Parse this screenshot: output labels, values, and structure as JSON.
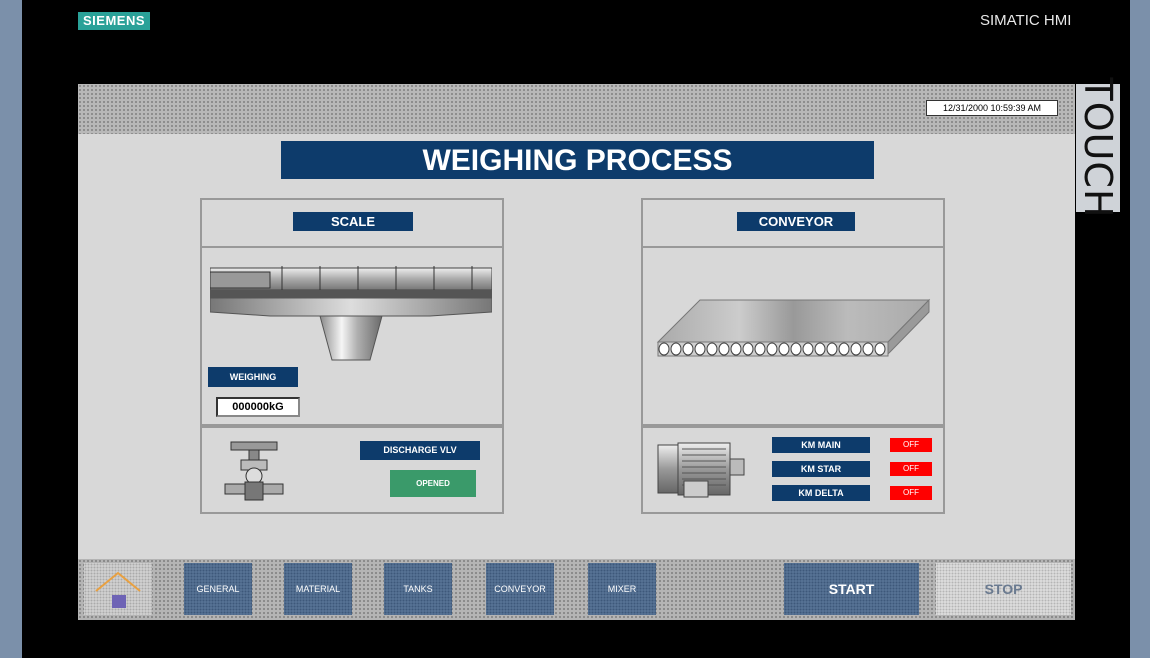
{
  "device": {
    "brand": "SIEMENS",
    "model": "SIMATIC HMI",
    "touch_label": "TOUCH"
  },
  "screen": {
    "datetime": "12/31/2000 10:59:39 AM",
    "title": "WEIGHING PROCESS"
  },
  "scale_panel": {
    "header": "SCALE",
    "weighing_label": "WEIGHING",
    "weight_value": "000000kG",
    "discharge_label": "DISCHARGE VLV",
    "discharge_status": "OPENED"
  },
  "conveyor_panel": {
    "header": "CONVEYOR",
    "contactors": [
      {
        "label": "KM MAIN",
        "state": "OFF"
      },
      {
        "label": "KM STAR",
        "state": "OFF"
      },
      {
        "label": "KM DELTA",
        "state": "OFF"
      }
    ]
  },
  "nav": {
    "general": "GENERAL",
    "material": "MATERIAL",
    "tanks": "TANKS",
    "conveyor": "CONVEYOR",
    "mixer": "MIXER",
    "start": "START",
    "stop": "STOP"
  },
  "colors": {
    "header_blue": "#0d3b6b",
    "status_green": "#3a9a6a",
    "alarm_red": "#ff0000",
    "nav_blue": "#5a7698"
  }
}
